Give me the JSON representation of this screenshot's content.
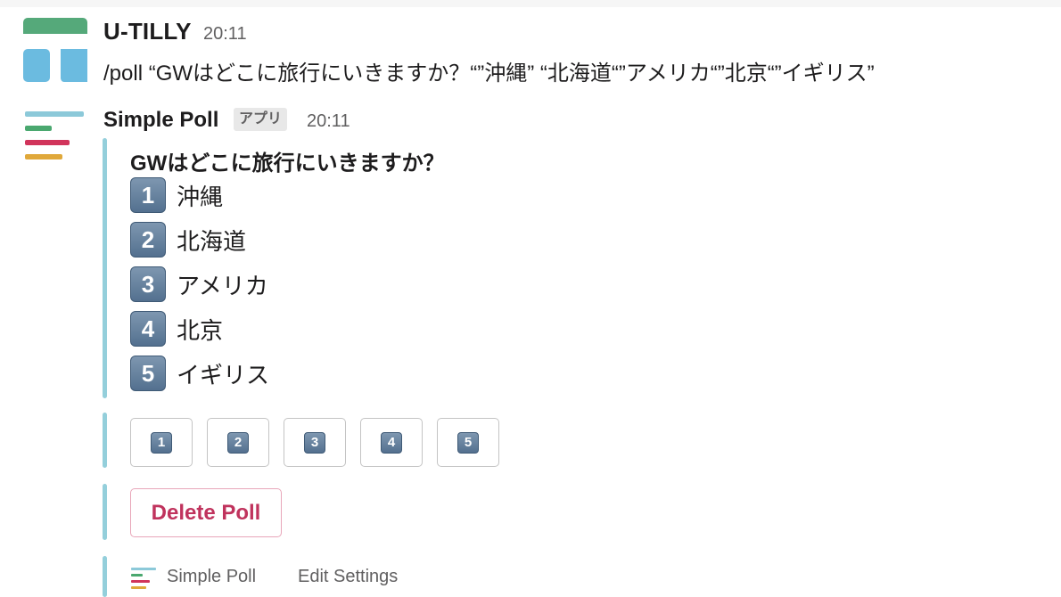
{
  "messages": [
    {
      "sender": "U-TILLY",
      "time": "20:11",
      "text": "/poll “GWはどこに旅行にいきますか？“”沖縄” “北海道“”アメリカ“”北京“”イギリス”",
      "avatar_icon": "u-tilly-logo-icon",
      "avatar_colors": {
        "top": "#55a97a",
        "bottom": "#6bbbe0"
      }
    },
    {
      "sender": "Simple Poll",
      "badge": "アプリ",
      "time": "20:11",
      "avatar_icon": "simple-poll-logo-icon",
      "avatar_colors": [
        "#8cc9d9",
        "#4aa86f",
        "#d1345b",
        "#e0a83a"
      ]
    }
  ],
  "poll": {
    "question": "GWはどこに旅行にいきますか？",
    "options": [
      {
        "number": "1",
        "label": "沖縄"
      },
      {
        "number": "2",
        "label": "北海道"
      },
      {
        "number": "3",
        "label": "アメリカ"
      },
      {
        "number": "4",
        "label": "北京"
      },
      {
        "number": "5",
        "label": "イギリス"
      }
    ],
    "vote_buttons": [
      "1",
      "2",
      "3",
      "4",
      "5"
    ],
    "delete_label": "Delete Poll"
  },
  "footer": {
    "app_name": "Simple Poll",
    "settings_label": "Edit Settings"
  },
  "colors": {
    "attachment_bar": "#94cfdb",
    "delete_text": "#c0335d",
    "keycap": "#607d9b"
  }
}
